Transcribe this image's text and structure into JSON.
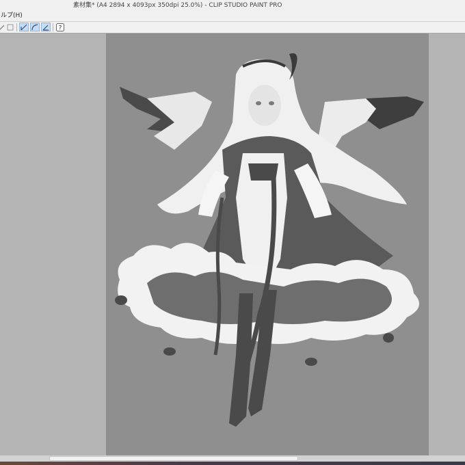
{
  "window": {
    "title": "素材集* (A4 2894 x 4093px 350dpi 25.0%)  - CLIP STUDIO PAINT PRO"
  },
  "menu": {
    "help_label": "ルプ(H)"
  },
  "toolbar": {
    "icons": [
      "pen-tool-icon",
      "square-icon",
      "ruler-pen-icon",
      "curve-pen-icon",
      "angle-pen-icon",
      "help-icon"
    ],
    "help_glyph": "?"
  },
  "canvas": {
    "document_name": "素材集",
    "zoom": "25.0%",
    "artwork": "grayscale character illustration with wings and cloud base",
    "colors": {
      "paper": "#8f8f8f",
      "light": "#f2f2f2",
      "mid": "#6a6a6a",
      "dark": "#4a4a4a"
    }
  }
}
